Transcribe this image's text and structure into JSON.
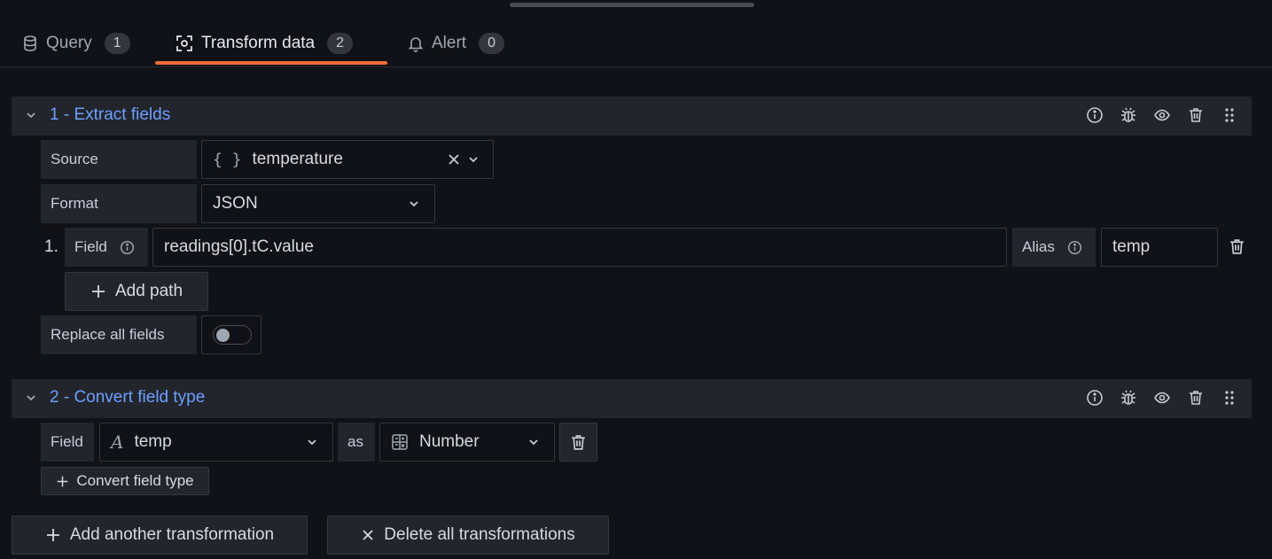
{
  "tabs": [
    {
      "label": "Query",
      "count": "1",
      "icon": "database-icon"
    },
    {
      "label": "Transform data",
      "count": "2",
      "icon": "transform-icon"
    },
    {
      "label": "Alert",
      "count": "0",
      "icon": "bell-icon"
    }
  ],
  "transformations": [
    {
      "title": "1 - Extract fields",
      "source_label": "Source",
      "source_value": "temperature",
      "source_icon": "{ }",
      "format_label": "Format",
      "format_value": "JSON",
      "path_index": "1.",
      "field_label": "Field",
      "field_value": "readings[0].tC.value",
      "alias_label": "Alias",
      "alias_value": "temp",
      "add_path_label": "Add path",
      "replace_label": "Replace all fields",
      "replace_on": false
    },
    {
      "title": "2 - Convert field type",
      "field_label": "Field",
      "field_value": "temp",
      "as_label": "as",
      "type_value": "Number",
      "add_label": "Convert field type"
    }
  ],
  "footer": {
    "add_label": "Add another transformation",
    "delete_label": "Delete all transformations"
  },
  "colors": {
    "background": "#111217",
    "accent_title": "#6e9fff",
    "tab_underline": "#f46a35"
  }
}
